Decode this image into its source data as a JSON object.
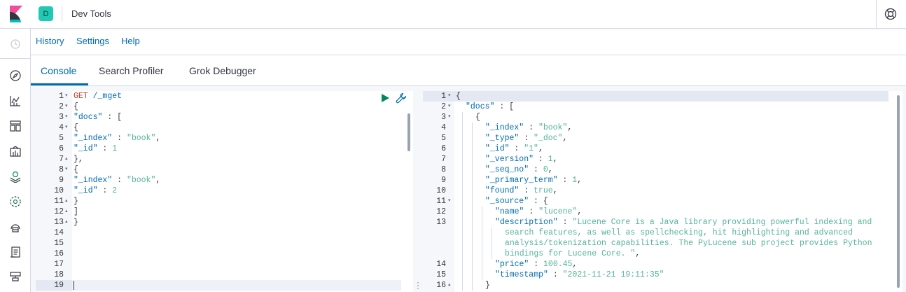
{
  "header": {
    "space_initial": "D",
    "app_title": "Dev Tools",
    "colors": {
      "brand_pink": "#f04e98",
      "brand_teal": "#00bfb3",
      "space_badge": "#20c9b4"
    }
  },
  "sidenav": {
    "items": [
      "clock-icon",
      "compass-icon",
      "chart-icon",
      "dashboard-icon",
      "canvas-icon",
      "maps-icon",
      "ml-icon",
      "infra-icon",
      "logs-icon",
      "devtools-icon"
    ]
  },
  "menu": {
    "history": "History",
    "settings": "Settings",
    "help": "Help"
  },
  "tabs": {
    "console": "Console",
    "search_profiler": "Search Profiler",
    "grok_debugger": "Grok Debugger",
    "active": "Console"
  },
  "request_editor": {
    "lines": [
      {
        "n": "1",
        "fold": "▾",
        "segments": [
          [
            "kw-get",
            "GET"
          ],
          [
            "p",
            " "
          ],
          [
            "kw-url",
            "/_mget"
          ]
        ]
      },
      {
        "n": "2",
        "fold": "▾",
        "segments": [
          [
            "p",
            "{"
          ]
        ]
      },
      {
        "n": "3",
        "fold": "▾",
        "segments": [
          [
            "q",
            "\"docs\""
          ],
          [
            "p",
            " : ["
          ]
        ]
      },
      {
        "n": "4",
        "fold": "▾",
        "segments": [
          [
            "p",
            "{"
          ]
        ]
      },
      {
        "n": "5",
        "fold": "",
        "segments": [
          [
            "q",
            "\"_index\""
          ],
          [
            "p",
            " : "
          ],
          [
            "s",
            "\"book\""
          ],
          [
            "p",
            ","
          ]
        ]
      },
      {
        "n": "6",
        "fold": "",
        "segments": [
          [
            "q",
            "\"_id\""
          ],
          [
            "p",
            " : "
          ],
          [
            "s",
            "1"
          ]
        ]
      },
      {
        "n": "7",
        "fold": "▴",
        "segments": [
          [
            "p",
            "},"
          ]
        ]
      },
      {
        "n": "8",
        "fold": "▾",
        "segments": [
          [
            "p",
            "{"
          ]
        ]
      },
      {
        "n": "9",
        "fold": "",
        "segments": [
          [
            "q",
            "\"_index\""
          ],
          [
            "p",
            " : "
          ],
          [
            "s",
            "\"book\""
          ],
          [
            "p",
            ","
          ]
        ]
      },
      {
        "n": "10",
        "fold": "",
        "segments": [
          [
            "q",
            "\"_id\""
          ],
          [
            "p",
            " : "
          ],
          [
            "s",
            "2"
          ]
        ]
      },
      {
        "n": "11",
        "fold": "▴",
        "segments": [
          [
            "p",
            "}"
          ]
        ]
      },
      {
        "n": "12",
        "fold": "▴",
        "segments": [
          [
            "p",
            "]"
          ]
        ]
      },
      {
        "n": "13",
        "fold": "▴",
        "segments": [
          [
            "p",
            "}"
          ]
        ]
      },
      {
        "n": "14",
        "fold": "",
        "segments": []
      },
      {
        "n": "15",
        "fold": "",
        "segments": []
      },
      {
        "n": "16",
        "fold": "",
        "segments": []
      },
      {
        "n": "17",
        "fold": "",
        "segments": []
      },
      {
        "n": "18",
        "fold": "",
        "segments": []
      },
      {
        "n": "19",
        "fold": "",
        "segments": []
      }
    ]
  },
  "response_viewer": {
    "lines": [
      {
        "n": "1",
        "fold": "▾",
        "indent": 0,
        "segments": [
          [
            "p",
            "{"
          ]
        ]
      },
      {
        "n": "2",
        "fold": "▾",
        "indent": 1,
        "segments": [
          [
            "q",
            "\"docs\""
          ],
          [
            "p",
            " : ["
          ]
        ]
      },
      {
        "n": "3",
        "fold": "▾",
        "indent": 2,
        "segments": [
          [
            "p",
            "{"
          ]
        ]
      },
      {
        "n": "4",
        "fold": "",
        "indent": 3,
        "segments": [
          [
            "q",
            "\"_index\""
          ],
          [
            "p",
            " : "
          ],
          [
            "s",
            "\"book\""
          ],
          [
            "p",
            ","
          ]
        ]
      },
      {
        "n": "5",
        "fold": "",
        "indent": 3,
        "segments": [
          [
            "q",
            "\"_type\""
          ],
          [
            "p",
            " : "
          ],
          [
            "s",
            "\"_doc\""
          ],
          [
            "p",
            ","
          ]
        ]
      },
      {
        "n": "6",
        "fold": "",
        "indent": 3,
        "segments": [
          [
            "q",
            "\"_id\""
          ],
          [
            "p",
            " : "
          ],
          [
            "s",
            "\"1\""
          ],
          [
            "p",
            ","
          ]
        ]
      },
      {
        "n": "7",
        "fold": "",
        "indent": 3,
        "segments": [
          [
            "q",
            "\"_version\""
          ],
          [
            "p",
            " : "
          ],
          [
            "s",
            "1"
          ],
          [
            "p",
            ","
          ]
        ]
      },
      {
        "n": "8",
        "fold": "",
        "indent": 3,
        "segments": [
          [
            "q",
            "\"_seq_no\""
          ],
          [
            "p",
            " : "
          ],
          [
            "s",
            "0"
          ],
          [
            "p",
            ","
          ]
        ]
      },
      {
        "n": "9",
        "fold": "",
        "indent": 3,
        "segments": [
          [
            "q",
            "\"_primary_term\""
          ],
          [
            "p",
            " : "
          ],
          [
            "s",
            "1"
          ],
          [
            "p",
            ","
          ]
        ]
      },
      {
        "n": "10",
        "fold": "",
        "indent": 3,
        "segments": [
          [
            "q",
            "\"found\""
          ],
          [
            "p",
            " : "
          ],
          [
            "s",
            "true"
          ],
          [
            "p",
            ","
          ]
        ]
      },
      {
        "n": "11",
        "fold": "▾",
        "indent": 3,
        "segments": [
          [
            "q",
            "\"_source\""
          ],
          [
            "p",
            " : {"
          ]
        ]
      },
      {
        "n": "12",
        "fold": "",
        "indent": 4,
        "segments": [
          [
            "q",
            "\"name\""
          ],
          [
            "p",
            " : "
          ],
          [
            "s",
            "\"lucene\""
          ],
          [
            "p",
            ","
          ]
        ]
      },
      {
        "n": "13",
        "fold": "",
        "indent": 4,
        "segments": [
          [
            "q",
            "\"description\""
          ],
          [
            "p",
            " : "
          ],
          [
            "s",
            "\"Lucene Core is a Java library providing powerful indexing and"
          ]
        ]
      },
      {
        "n": "",
        "fold": "",
        "indent": 5,
        "segments": [
          [
            "s",
            "search features, as well as spellchecking, hit highlighting and advanced"
          ]
        ]
      },
      {
        "n": "",
        "fold": "",
        "indent": 5,
        "segments": [
          [
            "s",
            "analysis/tokenization capabilities. The PyLucene sub project provides Python"
          ]
        ]
      },
      {
        "n": "",
        "fold": "",
        "indent": 5,
        "segments": [
          [
            "s",
            "bindings for Lucene Core. \""
          ],
          [
            "p",
            ","
          ]
        ]
      },
      {
        "n": "14",
        "fold": "",
        "indent": 4,
        "segments": [
          [
            "q",
            "\"price\""
          ],
          [
            "p",
            " : "
          ],
          [
            "s",
            "100.45"
          ],
          [
            "p",
            ","
          ]
        ]
      },
      {
        "n": "15",
        "fold": "",
        "indent": 4,
        "segments": [
          [
            "q",
            "\"timestamp\""
          ],
          [
            "p",
            " : "
          ],
          [
            "s",
            "\"2021-11-21 19:11:35\""
          ]
        ]
      },
      {
        "n": "16",
        "fold": "▴",
        "indent": 3,
        "segments": [
          [
            "p",
            "}"
          ]
        ]
      }
    ]
  }
}
